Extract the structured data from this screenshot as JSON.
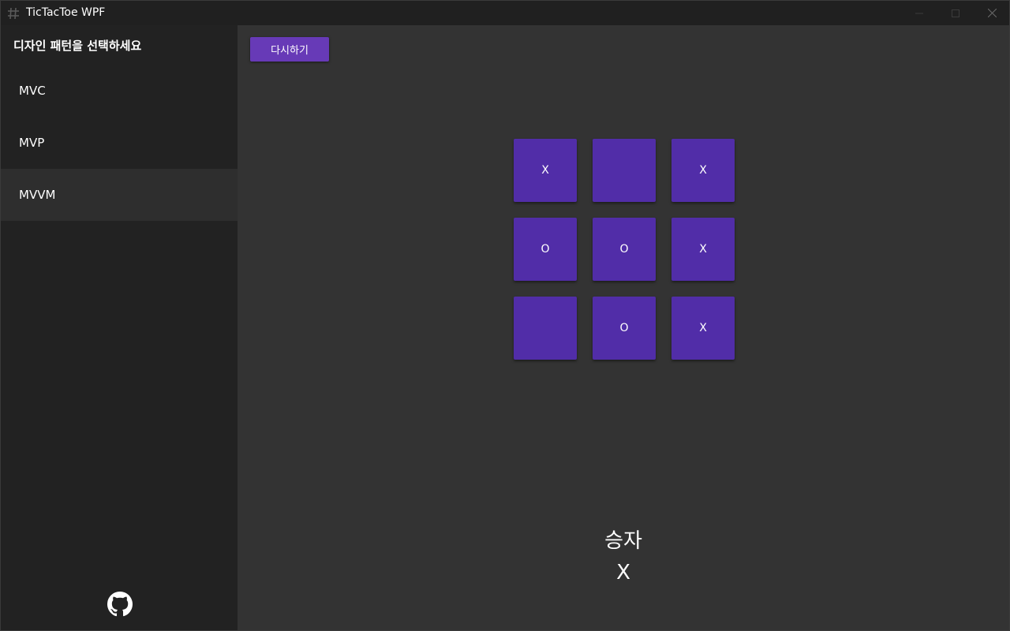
{
  "window": {
    "title": "TicTacToe WPF"
  },
  "sidebar": {
    "heading": "디자인 패턴을 선택하세요",
    "items": [
      {
        "label": "MVC"
      },
      {
        "label": "MVP"
      },
      {
        "label": "MVVM",
        "selected": true
      }
    ],
    "footer_icon": "github-icon"
  },
  "toolbar": {
    "restart_label": "다시하기"
  },
  "board": {
    "cells": [
      "X",
      "",
      "X",
      "O",
      "O",
      "X",
      "",
      "O",
      "X"
    ]
  },
  "result": {
    "label": "승자",
    "winner": "X"
  },
  "colors": {
    "accent": "#673ab7",
    "cell": "#512da8",
    "sidebar_bg": "#222222",
    "main_bg": "#333333",
    "titlebar_bg": "#202020",
    "selected_item_bg": "#2e2e2e"
  }
}
